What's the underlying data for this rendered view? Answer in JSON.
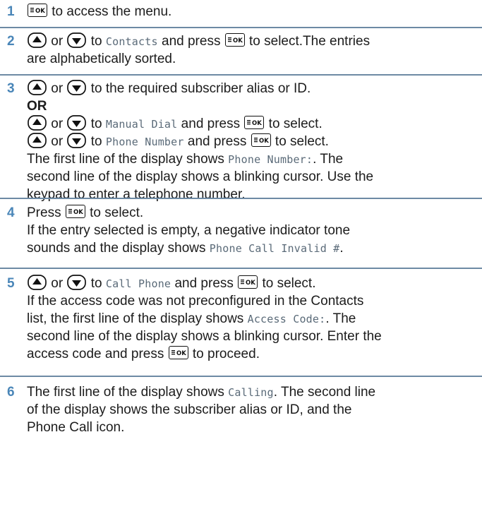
{
  "steps": [
    {
      "number": "1",
      "lines": [
        [
          {
            "k": "ok"
          },
          {
            "t": " to access the menu."
          }
        ]
      ]
    },
    {
      "number": "2",
      "lines": [
        [
          {
            "k": "up"
          },
          {
            "t": " or "
          },
          {
            "k": "down"
          },
          {
            "t": " to "
          },
          {
            "m": "Contacts"
          },
          {
            "t": " and press "
          },
          {
            "k": "ok"
          },
          {
            "t": " to select.The entries"
          }
        ],
        [
          {
            "t": "are alphabetically sorted."
          }
        ]
      ]
    },
    {
      "number": "3",
      "lines": [
        [
          {
            "k": "up"
          },
          {
            "t": " or "
          },
          {
            "k": "down"
          },
          {
            "t": " to the required subscriber alias or ID."
          }
        ],
        [
          {
            "b": "OR"
          }
        ],
        [
          {
            "k": "up"
          },
          {
            "t": " or "
          },
          {
            "k": "down"
          },
          {
            "t": " to "
          },
          {
            "m": "Manual Dial"
          },
          {
            "t": " and press "
          },
          {
            "k": "ok"
          },
          {
            "t": " to select."
          }
        ],
        [
          {
            "k": "up"
          },
          {
            "t": " or "
          },
          {
            "k": "down"
          },
          {
            "t": " to "
          },
          {
            "m": "Phone Number"
          },
          {
            "t": " and press "
          },
          {
            "k": "ok"
          },
          {
            "t": " to select."
          }
        ],
        [
          {
            "t": "The first line of the display shows "
          },
          {
            "m": "Phone Number:"
          },
          {
            "t": ". The"
          }
        ],
        [
          {
            "t": "second line of the display shows a blinking cursor. Use the"
          }
        ],
        [
          {
            "t": "keypad to enter a telephone number."
          }
        ]
      ]
    },
    {
      "number": "4",
      "lines": [
        [
          {
            "t": "Press "
          },
          {
            "k": "ok"
          },
          {
            "t": " to select."
          }
        ],
        [
          {
            "t": "If the entry selected is empty, a negative indicator tone"
          }
        ],
        [
          {
            "t": "sounds and the display shows "
          },
          {
            "m": "Phone Call Invalid #"
          },
          {
            "t": "."
          }
        ]
      ]
    },
    {
      "number": "5",
      "lines": [
        [
          {
            "k": "up"
          },
          {
            "t": " or "
          },
          {
            "k": "down"
          },
          {
            "t": " to "
          },
          {
            "m": "Call Phone"
          },
          {
            "t": " and press "
          },
          {
            "k": "ok"
          },
          {
            "t": " to select."
          }
        ],
        [
          {
            "t": "If the access code was not preconfigured in the Contacts"
          }
        ],
        [
          {
            "t": "list, the first line of the display shows "
          },
          {
            "m": "Access Code:"
          },
          {
            "t": ". The"
          }
        ],
        [
          {
            "t": "second line of the display shows a blinking cursor. Enter the"
          }
        ],
        [
          {
            "t": "access code and press "
          },
          {
            "k": "ok"
          },
          {
            "t": " to proceed."
          }
        ]
      ]
    },
    {
      "number": "6",
      "lines": [
        [
          {
            "t": "The first line of the display shows "
          },
          {
            "m": "Calling"
          },
          {
            "t": ". The second line"
          }
        ],
        [
          {
            "t": "of the display shows the subscriber alias or ID, and the"
          }
        ],
        [
          {
            "t": "Phone Call icon."
          }
        ]
      ]
    }
  ],
  "icons": {
    "ok": "menu-ok-key-icon",
    "up": "up-arrow-key-icon",
    "down": "down-arrow-key-icon"
  },
  "colors": {
    "step_number": "#4a86b8",
    "separator": "#6d8aa4",
    "display_text": "#5a6a78"
  }
}
